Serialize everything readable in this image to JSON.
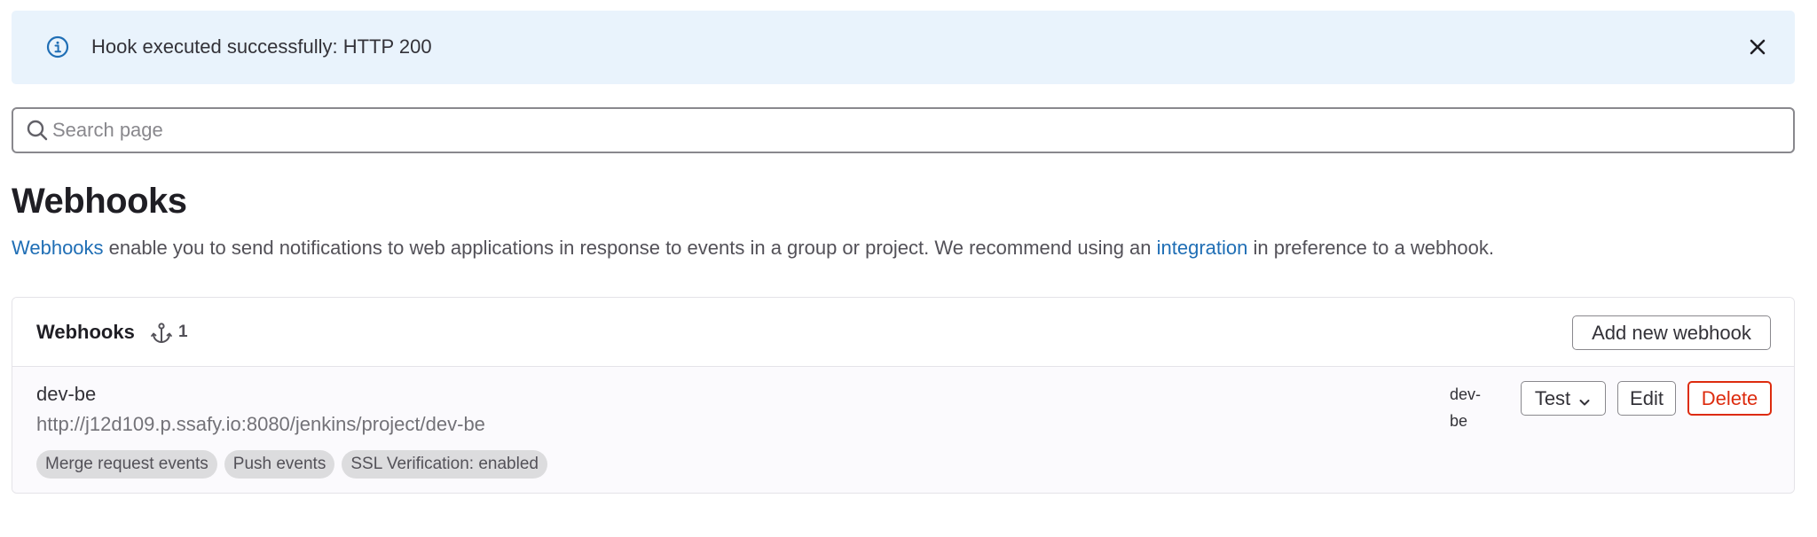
{
  "alert": {
    "message": "Hook executed successfully: HTTP 200",
    "icon": "info-circle-icon",
    "close_icon": "close-icon",
    "background": "#e9f3fc"
  },
  "search": {
    "placeholder": "Search page",
    "value": ""
  },
  "page": {
    "title": "Webhooks",
    "description_link_webhooks": "Webhooks",
    "description_middle": " enable you to send notifications to web applications in response to events in a group or project. We recommend using an ",
    "description_link_integration": "integration",
    "description_end": " in preference to a webhook."
  },
  "card": {
    "title": "Webhooks",
    "count_icon": "hook-icon",
    "count": "1",
    "add_button_label": "Add new webhook"
  },
  "hooks": [
    {
      "name": "dev-be",
      "url": "http://j12d109.p.ssafy.io:8080/jenkins/project/dev-be",
      "badges": [
        "Merge request events",
        "Push events",
        "SSL Verification: enabled"
      ],
      "branch_filter": "dev-be",
      "test_label": "Test",
      "edit_label": "Edit",
      "delete_label": "Delete"
    }
  ],
  "colors": {
    "link": "#1f6eb5",
    "danger": "#dd2b0e",
    "badge_bg": "#dcdcde"
  }
}
